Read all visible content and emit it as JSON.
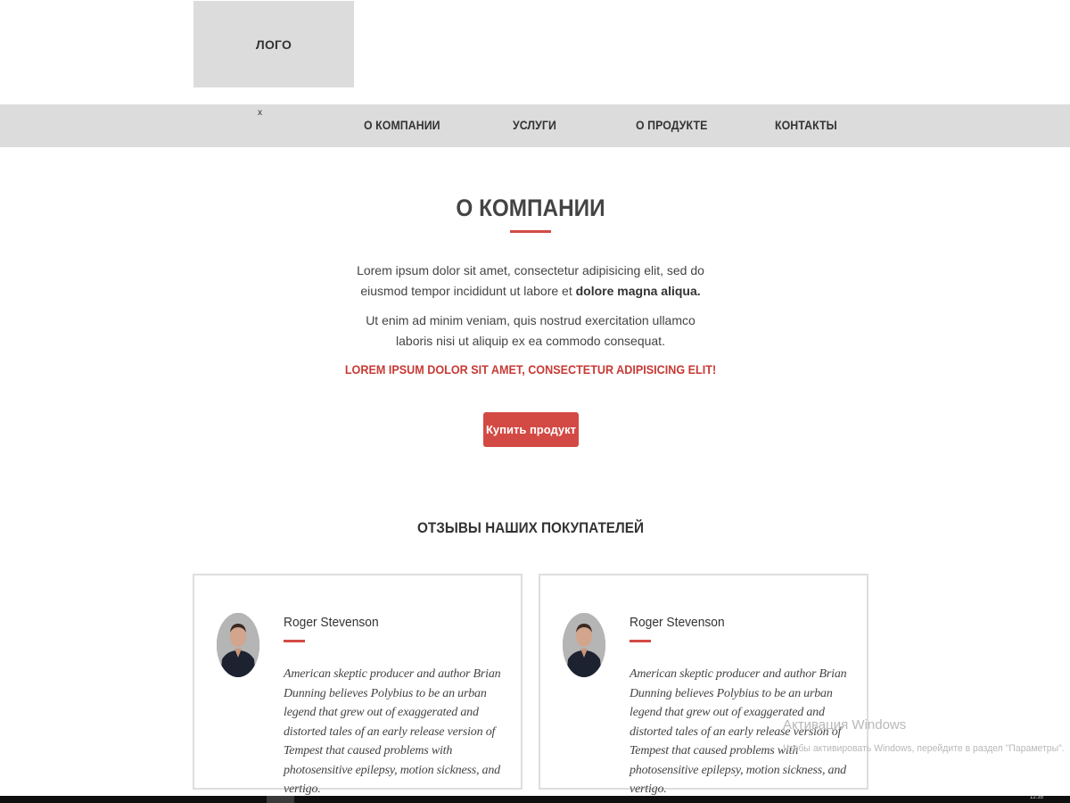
{
  "header": {
    "logo_label": "ЛОГО"
  },
  "nav": {
    "close_label": "x",
    "items": [
      {
        "label": "О КОМПАНИИ"
      },
      {
        "label": "УСЛУГИ"
      },
      {
        "label": "О ПРОДУКТЕ"
      },
      {
        "label": "КОНТАКТЫ"
      }
    ]
  },
  "about": {
    "title": "О КОМПАНИИ",
    "paragraph1_text": "Lorem ipsum dolor sit amet, consectetur adipisicing elit, sed do eiusmod tempor incididunt ut labore et ",
    "paragraph1_bold": "dolore magna aliqua.",
    "paragraph2": "Ut enim ad minim veniam, quis nostrud exercitation ullamco laboris nisi ut aliquip ex ea commodo consequat.",
    "highlight": "LOREM IPSUM DOLOR SIT AMET, CONSECTETUR ADIPISICING ELIT!",
    "buy_button_label": "Купить продукт"
  },
  "reviews": {
    "title": "ОТЗЫВЫ НАШИХ ПОКУПАТЕЛЕЙ",
    "items": [
      {
        "name": "Roger Stevenson",
        "text": "American skeptic producer and author Brian Dunning believes Polybius to be an urban legend that grew out of exaggerated and distorted tales of an early release version of Tempest that caused problems with photosensitive epilepsy, motion sickness, and vertigo."
      },
      {
        "name": "Roger Stevenson",
        "text": "American skeptic producer and author Brian Dunning believes Polybius to be an urban legend that grew out of exaggerated and distorted tales of an early release version of Tempest that caused problems with photosensitive epilepsy, motion sickness, and vertigo."
      }
    ]
  },
  "watermark": {
    "title": "Активация Windows",
    "subtitle": "Чтобы активировать Windows, перейдите в раздел \"Параметры\"."
  },
  "taskbar": {
    "clock": "12:35"
  },
  "colors": {
    "accent": "#d34a44",
    "nav_bg": "#dcdcdc",
    "text": "#333333"
  }
}
